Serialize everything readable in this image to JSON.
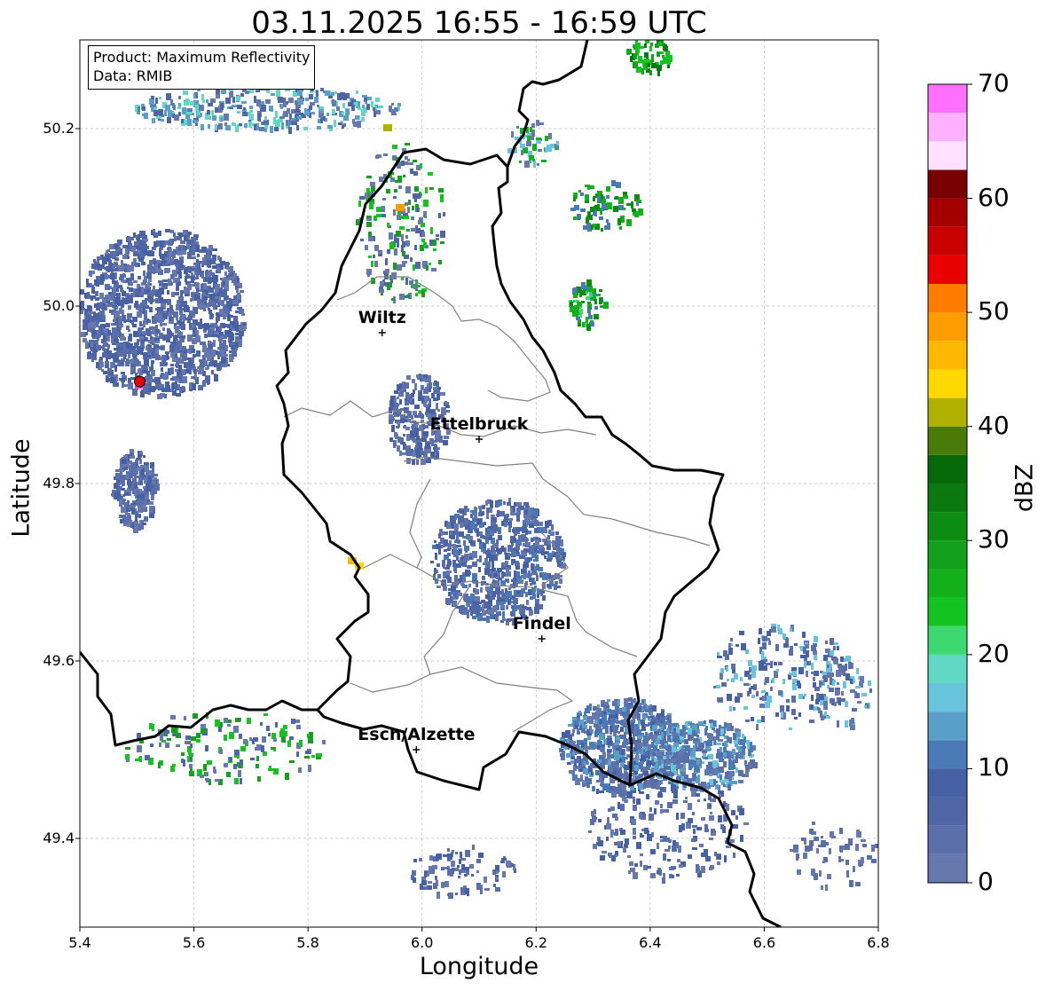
{
  "title": "03.11.2025 16:55 - 16:59 UTC",
  "axes": {
    "xlabel": "Longitude",
    "ylabel": "Latitude",
    "xlim": [
      5.4,
      6.8
    ],
    "ylim": [
      49.3,
      50.3
    ],
    "xticks": [
      "5.4",
      "5.6",
      "5.8",
      "6.0",
      "6.2",
      "6.4",
      "6.6",
      "6.8"
    ],
    "yticks": [
      "49.4",
      "49.6",
      "49.8",
      "50.0",
      "50.2"
    ],
    "grid": true
  },
  "info": {
    "product": "Product: Maximum Reflectivity",
    "data": "Data: RMIB"
  },
  "cities": [
    {
      "name": "Wiltz",
      "lon": 5.93,
      "lat": 49.97
    },
    {
      "name": "Ettelbruck",
      "lon": 6.1,
      "lat": 49.85
    },
    {
      "name": "Findel",
      "lon": 6.21,
      "lat": 49.625
    },
    {
      "name": "Esch/Alzette",
      "lon": 5.99,
      "lat": 49.5
    }
  ],
  "radar_site": {
    "lon": 5.505,
    "lat": 49.915
  },
  "colorbar": {
    "label": "dBZ",
    "ticks": [
      "0",
      "10",
      "20",
      "30",
      "40",
      "50",
      "60",
      "70"
    ],
    "vmin": 0,
    "vmax": 70,
    "colors": [
      "#6678ad",
      "#5a6eaa",
      "#4f65a5",
      "#4560a4",
      "#4a7ab5",
      "#58a0c8",
      "#68c3dc",
      "#60d8c4",
      "#3ed870",
      "#12c420",
      "#12b01a",
      "#13a01a",
      "#0d8c12",
      "#0a7a10",
      "#066a0a",
      "#4a7a0a",
      "#b0b000",
      "#ffd800",
      "#ffb800",
      "#ff9c00",
      "#ff7c00",
      "#e80000",
      "#c80000",
      "#a40000",
      "#780000",
      "#ffe0ff",
      "#ffb0ff",
      "#ff70ff",
      "#e838e8"
    ]
  }
}
